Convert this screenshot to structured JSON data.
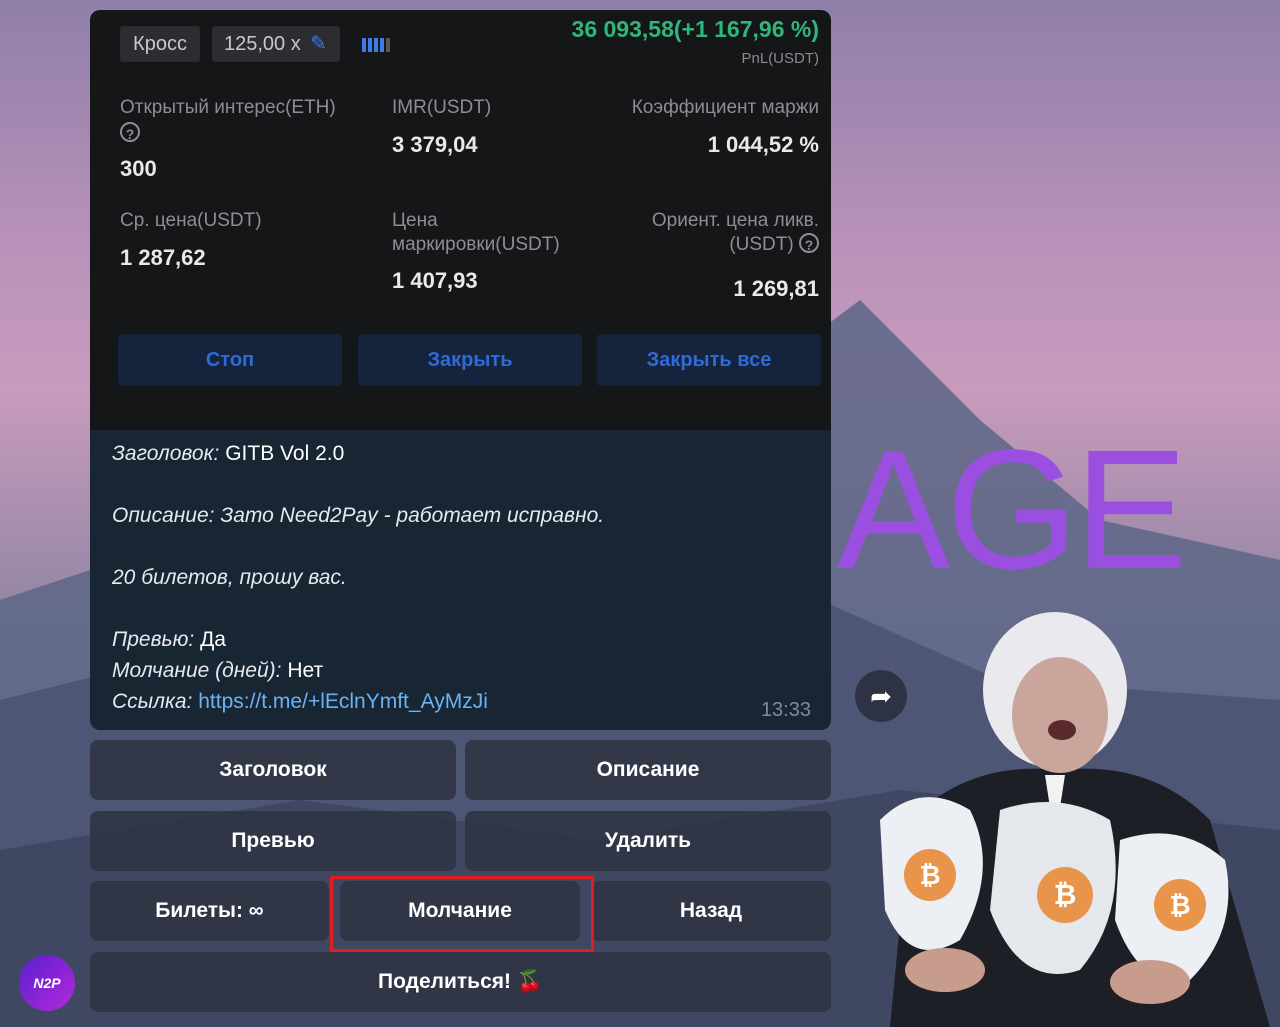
{
  "trade": {
    "margin_mode": "Кросс",
    "leverage": "125,00 x",
    "pnl": "36 093,58(+1 167,96 %)",
    "pnl_label": "PnL(USDT)",
    "open_interest_label": "Открытый интерес(ETH)",
    "open_interest_value": "300",
    "imr_label": "IMR(USDT)",
    "imr_value": "3 379,04",
    "margin_ratio_label": "Коэффициент маржи",
    "margin_ratio_value": "1 044,52 %",
    "avg_price_label": "Ср. цена(USDT)",
    "avg_price_value": "1 287,62",
    "mark_price_label_1": "Цена",
    "mark_price_label_2": "маркировки(USDT)",
    "mark_price_value": "1 407,93",
    "liq_label_1": "Ориент. цена ликв.",
    "liq_label_2": "(USDT)",
    "liq_value": "1 269,81",
    "btn_stop": "Стоп",
    "btn_close": "Закрыть",
    "btn_close_all": "Закрыть все",
    "help_glyph": "?"
  },
  "message": {
    "title_label": "Заголовок:",
    "title_value": "GITB Vol 2.0",
    "desc_line": "Описание: Зато Need2Pay - работает исправно.",
    "tickets_line": "20 билетов, прошу вас.",
    "preview_label": "Превью:",
    "preview_value": "Да",
    "silence_label": "Молчание (дней):",
    "silence_value": "Нет",
    "link_label": "Ссылка:",
    "link_value": "https://t.me/+lEclnYmft_AyMzJi",
    "time": "13:33"
  },
  "keyboard": {
    "title": "Заголовок",
    "description": "Описание",
    "preview": "Превью",
    "delete": "Удалить",
    "tickets": "Билеты: ∞",
    "silence": "Молчание",
    "back": "Назад",
    "share": "Поделиться! 🍒"
  },
  "overlay": {
    "rage": "RAGE",
    "logo": "N2P",
    "bitcoin": "₿"
  },
  "colors": {
    "pnl_green": "#2fb67b",
    "highlight_red": "#e01e1e",
    "rage_purple": "#9b4fe0",
    "link_blue": "#6ab3f3"
  }
}
